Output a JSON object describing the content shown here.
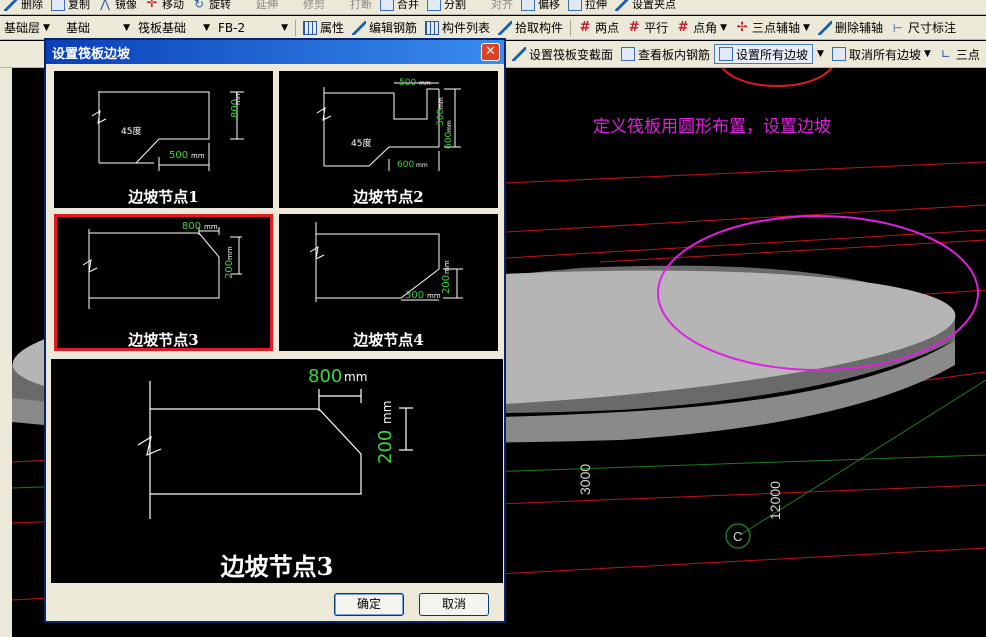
{
  "toolbar_top": {
    "items": [
      "删除",
      "复制",
      "镜像",
      "移动",
      "旋转",
      "延伸",
      "修剪",
      "打断",
      "合并",
      "分割",
      "对齐",
      "偏移",
      "拉伸",
      "设置夹点"
    ]
  },
  "toolbar_mid": {
    "floor_combo": "基础层",
    "type_combo": "基础",
    "category_combo": "筏板基础",
    "element_combo": "FB-2",
    "items": [
      "属性",
      "编辑钢筋",
      "构件列表",
      "拾取构件",
      "两点",
      "平行",
      "点角",
      "三点辅轴",
      "删除辅轴",
      "尺寸标注"
    ]
  },
  "toolbar_bottom": {
    "items": [
      "设置筏板变截面",
      "查看板内钢筋",
      "设置所有边坡",
      "取消所有边坡",
      "三点"
    ]
  },
  "scene": {
    "annotation": "定义筏板用圆形布置，设置边坡",
    "dim_3000": "3000",
    "dim_12000": "12000",
    "axis_label": "C",
    "annotation_color": "#e020e0",
    "highlight_circle_color": "#e01b24"
  },
  "dialog": {
    "title": "设置筏板边坡",
    "close_glyph": "✕",
    "tiles": [
      {
        "caption": "边坡节点1",
        "labels": [
          "45度",
          "800",
          "mm",
          "500",
          "mm"
        ]
      },
      {
        "caption": "边坡节点2",
        "labels": [
          "500",
          "mm",
          "300",
          "mm",
          "600",
          "mm",
          "45度",
          "600",
          "mm"
        ]
      },
      {
        "caption": "边坡节点3",
        "labels": [
          "800",
          "mm",
          "200",
          "mm"
        ]
      },
      {
        "caption": "边坡节点4",
        "labels": [
          "200",
          "mm",
          "300",
          "mm"
        ]
      }
    ],
    "selected_index": 2,
    "preview": {
      "caption": "边坡节点3",
      "dim_top": "800",
      "unit_top": "mm",
      "dim_side": "200",
      "unit_side": "mm"
    },
    "ok_label": "确定",
    "cancel_label": "取消"
  }
}
